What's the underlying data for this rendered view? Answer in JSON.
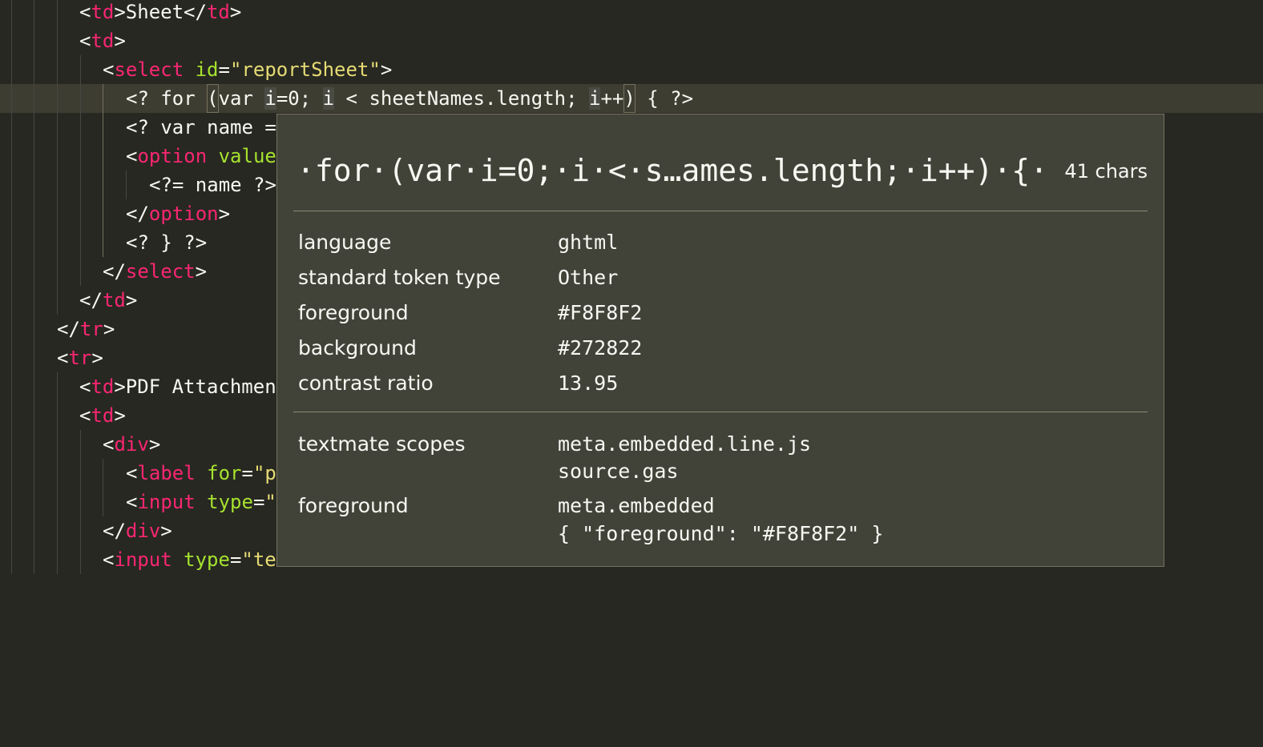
{
  "code": {
    "lines": [
      {
        "parts": [
          "<",
          "td",
          ">Sheet</",
          "td",
          ">"
        ]
      },
      {
        "parts": [
          "<",
          "td",
          ">"
        ]
      },
      {
        "parts": [
          "<",
          "select",
          " ",
          "id",
          "=",
          "\"reportSheet\"",
          ">"
        ]
      },
      {
        "parts": [
          "<? for ",
          "(",
          "var ",
          "i",
          "=0; ",
          "i",
          " < sheetNames.length; ",
          "i",
          "++",
          ")",
          " { ?>"
        ]
      },
      {
        "parts": [
          "<? var name ="
        ]
      },
      {
        "parts": [
          "<",
          "option",
          " ",
          "value"
        ]
      },
      {
        "parts": [
          "<?= name ?>"
        ]
      },
      {
        "parts": [
          "</",
          "option",
          ">"
        ]
      },
      {
        "parts": [
          "<? } ?>"
        ]
      },
      {
        "parts": [
          "</",
          "select",
          ">"
        ]
      },
      {
        "parts": [
          "</",
          "td",
          ">"
        ]
      },
      {
        "parts": [
          "</",
          "tr",
          ">"
        ]
      },
      {
        "parts": [
          "<",
          "tr",
          ">"
        ]
      },
      {
        "parts": [
          "<",
          "td",
          ">PDF Attachmen"
        ]
      },
      {
        "parts": [
          "<",
          "td",
          ">"
        ]
      },
      {
        "parts": [
          "<",
          "div",
          ">"
        ]
      },
      {
        "parts": [
          "<",
          "label",
          " ",
          "for",
          "=",
          "\"p"
        ]
      },
      {
        "parts": [
          "<",
          "input",
          " ",
          "type",
          "=",
          "\""
        ]
      },
      {
        "parts": [
          "</",
          "div",
          ">"
        ]
      },
      {
        "parts": [
          "<",
          "input",
          " ",
          "type",
          "=",
          "\"te"
        ]
      }
    ]
  },
  "hover": {
    "token_text": "·for·(var·i=0;·i·<·s…ames.length;·i++)·{·",
    "char_count": "41 chars",
    "language_label": "language",
    "language_value": "ghtml",
    "token_type_label": "standard token type",
    "token_type_value": "Other",
    "foreground_label": "foreground",
    "foreground_value": "#F8F8F2",
    "background_label": "background",
    "background_value": "#272822",
    "contrast_label": "contrast ratio",
    "contrast_value": "13.95",
    "scopes_label": "textmate scopes",
    "scope_1": "meta.embedded.line.js",
    "scope_2": "source.gas",
    "theme_foreground_label": "foreground",
    "theme_rule": "meta.embedded",
    "theme_rule_value": "{ \"foreground\": \"#F8F8F2\" }"
  },
  "colors": {
    "editor_bg": "#272822",
    "tag": "#F92672",
    "attribute": "#A6E22E",
    "string": "#E6DB74",
    "text": "#F8F8F2",
    "hover_bg": "#414339"
  }
}
